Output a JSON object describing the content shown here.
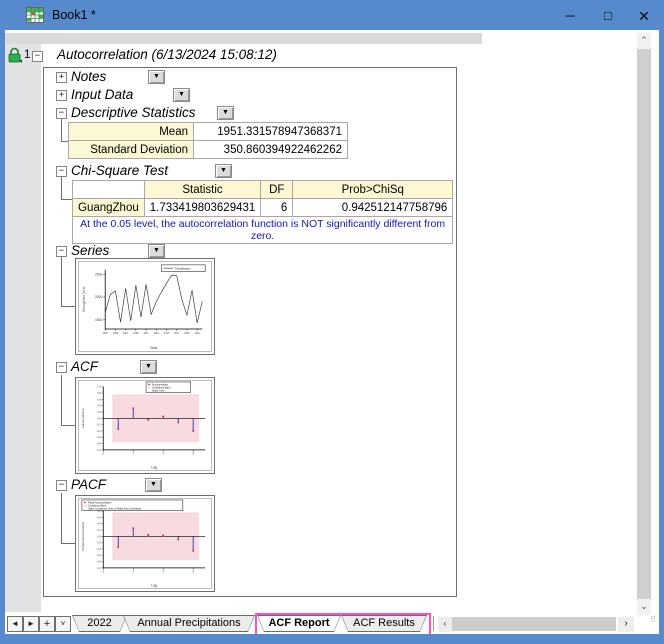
{
  "window": {
    "title": "Book1 *",
    "controls": {
      "minimize": "─",
      "maximize": "□",
      "close": "✕"
    }
  },
  "row": {
    "number": "1"
  },
  "report": {
    "title": "Autocorrelation (6/13/2024 15:08:12)",
    "sections": [
      {
        "id": "notes",
        "label": "Notes",
        "collapsed": true,
        "toggle": "+"
      },
      {
        "id": "input-data",
        "label": "Input Data",
        "collapsed": true,
        "toggle": "+"
      },
      {
        "id": "descriptive-statistics",
        "label": "Descriptive Statistics",
        "collapsed": false,
        "toggle": "−",
        "table": {
          "rows": [
            [
              "Mean",
              "1951.331578947368371"
            ],
            [
              "Standard Deviation",
              "350.860394922462262"
            ]
          ]
        }
      },
      {
        "id": "chi-square-test",
        "label": "Chi-Square Test",
        "collapsed": false,
        "toggle": "−",
        "table": {
          "headers": [
            "",
            "Statistic",
            "DF",
            "Prob>ChiSq"
          ],
          "rows": [
            [
              "GuangZhou",
              "1.733419803629431",
              "6",
              "0.942512147758796"
            ]
          ],
          "footnote": "At the 0.05 level, the autocorrelation function is NOT significantly different from zero."
        }
      },
      {
        "id": "series",
        "label": "Series",
        "collapsed": false,
        "toggle": "−"
      },
      {
        "id": "acf",
        "label": "ACF",
        "collapsed": false,
        "toggle": "−"
      },
      {
        "id": "pacf",
        "label": "PACF",
        "collapsed": false,
        "toggle": "−"
      }
    ]
  },
  "chart_data": [
    {
      "id": "series",
      "type": "line",
      "title": "",
      "xlabel": "Year",
      "ylabel": "GuangZhou (Mm)",
      "legend": [
        "Precipitation"
      ],
      "legend_position": "top-right",
      "x": [
        2003,
        2004,
        2005,
        2006,
        2007,
        2008,
        2009,
        2010,
        2011,
        2012,
        2013,
        2014,
        2015,
        2016,
        2017,
        2018,
        2019,
        2020,
        2021,
        2022
      ],
      "values": [
        1660,
        2060,
        2130,
        1450,
        2190,
        1480,
        2260,
        1560,
        2280,
        1620,
        1900,
        2110,
        2300,
        2480,
        2465,
        1950,
        1600,
        2150,
        1430,
        1905
      ],
      "ylim": [
        1300,
        2600
      ],
      "yticks": [
        1500,
        2000,
        2500
      ],
      "xticks": [
        2003,
        2005,
        2007,
        2009,
        2011,
        2013,
        2015,
        2017,
        2019,
        2021
      ],
      "grid": false,
      "line_color": "#3a3a3a"
    },
    {
      "id": "acf",
      "type": "stem",
      "title": "",
      "xlabel": "Lag",
      "ylabel": "Autocorrelation",
      "legend": [
        "Autocorrelation",
        "Confidence Band",
        "Upper Limit"
      ],
      "legend_position": "top-right",
      "x": [
        1,
        2,
        3,
        4,
        5,
        6
      ],
      "values": [
        -0.34,
        0.32,
        -0.05,
        0.06,
        -0.13,
        -0.4
      ],
      "confidence_band": {
        "x": [
          0.6,
          6.4
        ],
        "y": [
          -0.76,
          0.76
        ]
      },
      "ylim": [
        -1,
        1
      ],
      "yticks": [
        1.0,
        0.8,
        0.6,
        0.4,
        0.2,
        0.0,
        -0.2,
        -0.4,
        -0.6,
        -0.8,
        -1.0
      ],
      "xticks": [
        0,
        2,
        4,
        6
      ],
      "xlim": [
        0,
        6.8
      ],
      "grid": false
    },
    {
      "id": "pacf",
      "type": "stem",
      "title": "",
      "xlabel": "Lag",
      "ylabel": "Partial Autocorrelation",
      "legend": [
        "Partial Autocorrelation",
        "Confidence Band",
        "Upper Confidence Limit of Partial Auto-Correlation"
      ],
      "legend_position": "top-left",
      "x": [
        1,
        2,
        3,
        4,
        5,
        6
      ],
      "values": [
        -0.34,
        0.26,
        0.05,
        0.03,
        -0.1,
        -0.46
      ],
      "confidence_band": {
        "x": [
          0.6,
          6.4
        ],
        "y": [
          -0.76,
          0.76
        ]
      },
      "ylim": [
        -1,
        1
      ],
      "yticks": [
        1.0,
        0.8,
        0.6,
        0.4,
        0.2,
        0.0,
        -0.2,
        -0.4,
        -0.6,
        -0.8,
        -1.0
      ],
      "xticks": [
        0,
        2,
        4,
        6
      ],
      "xlim": [
        0,
        6.8
      ],
      "grid": false
    }
  ],
  "tabs": {
    "nav": {
      "prev": "◄",
      "next": "►",
      "add": "+",
      "list": "˅"
    },
    "items": [
      {
        "label": "2022",
        "active": false
      },
      {
        "label": "Annual Precipitations",
        "active": false
      },
      {
        "label": "ACF Report",
        "active": true
      },
      {
        "label": "ACF Results",
        "active": false
      }
    ],
    "highlight_color": "#ff4fc8"
  },
  "scrollbars": {
    "up": "⌃",
    "down": "⌄",
    "left": "‹",
    "right": "›",
    "grip": "⠿"
  },
  "colors": {
    "titlebar": "#578acd",
    "table_label_bg": "#fcf8d4",
    "footnote_text": "#1414cc",
    "confidence_band": "#f8dbe1",
    "stem": "#2a2aad",
    "marker": "#d01828",
    "lock": "#2eae4e",
    "tab_highlight": "#ff4fc8"
  }
}
